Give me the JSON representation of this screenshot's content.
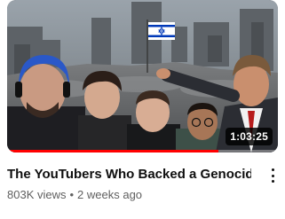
{
  "video": {
    "title": "The YouTubers Who Backed a Genocide",
    "views": "803K views",
    "separator": "•",
    "age": "2 weeks ago",
    "duration": "1:03:25",
    "progress_fraction": 0.78
  },
  "menu": {
    "icon": "more-vert-icon"
  },
  "colors": {
    "progress": "#ff0000",
    "title": "#0f0f0f",
    "meta": "#606060",
    "flag_blue": "#0038b8"
  }
}
